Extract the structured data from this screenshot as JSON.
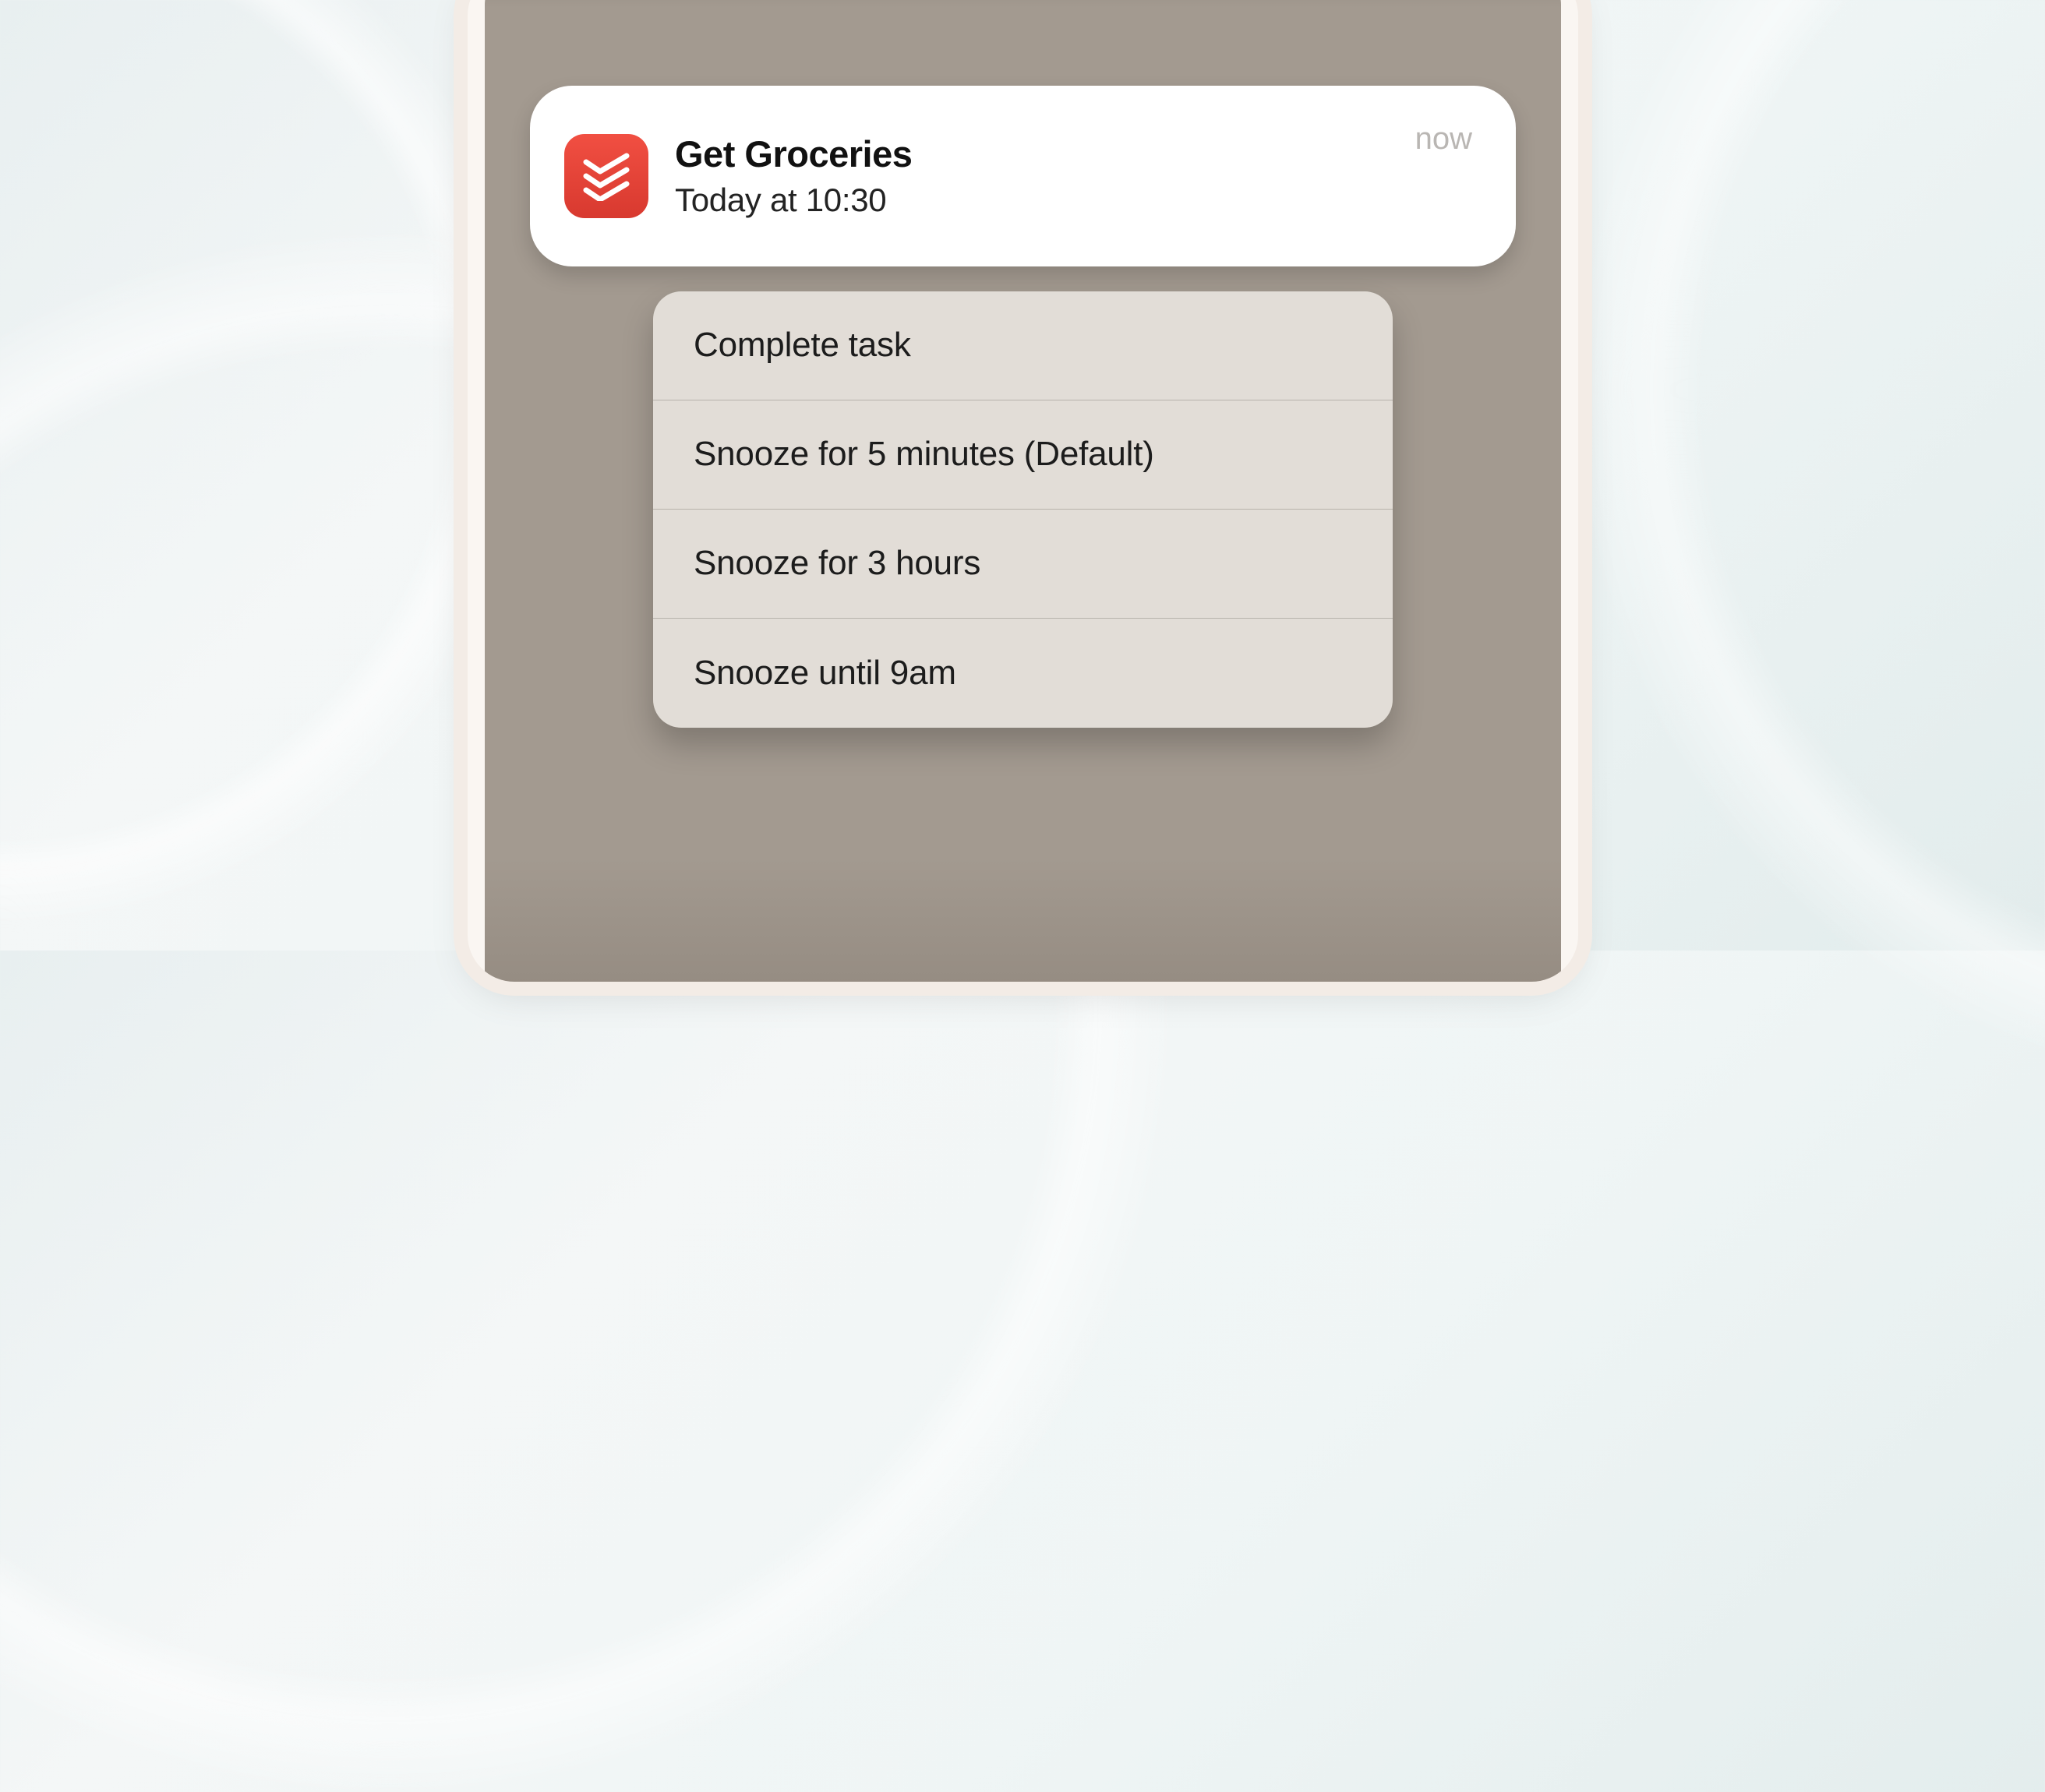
{
  "notification": {
    "title": "Get Groceries",
    "subtitle": "Today at 10:30",
    "timestamp": "now",
    "app_icon": "todoist-icon"
  },
  "actions": [
    {
      "label": "Complete task"
    },
    {
      "label": "Snooze for 5 minutes (Default)"
    },
    {
      "label": "Snooze for 3 hours"
    },
    {
      "label": "Snooze until 9am"
    }
  ]
}
